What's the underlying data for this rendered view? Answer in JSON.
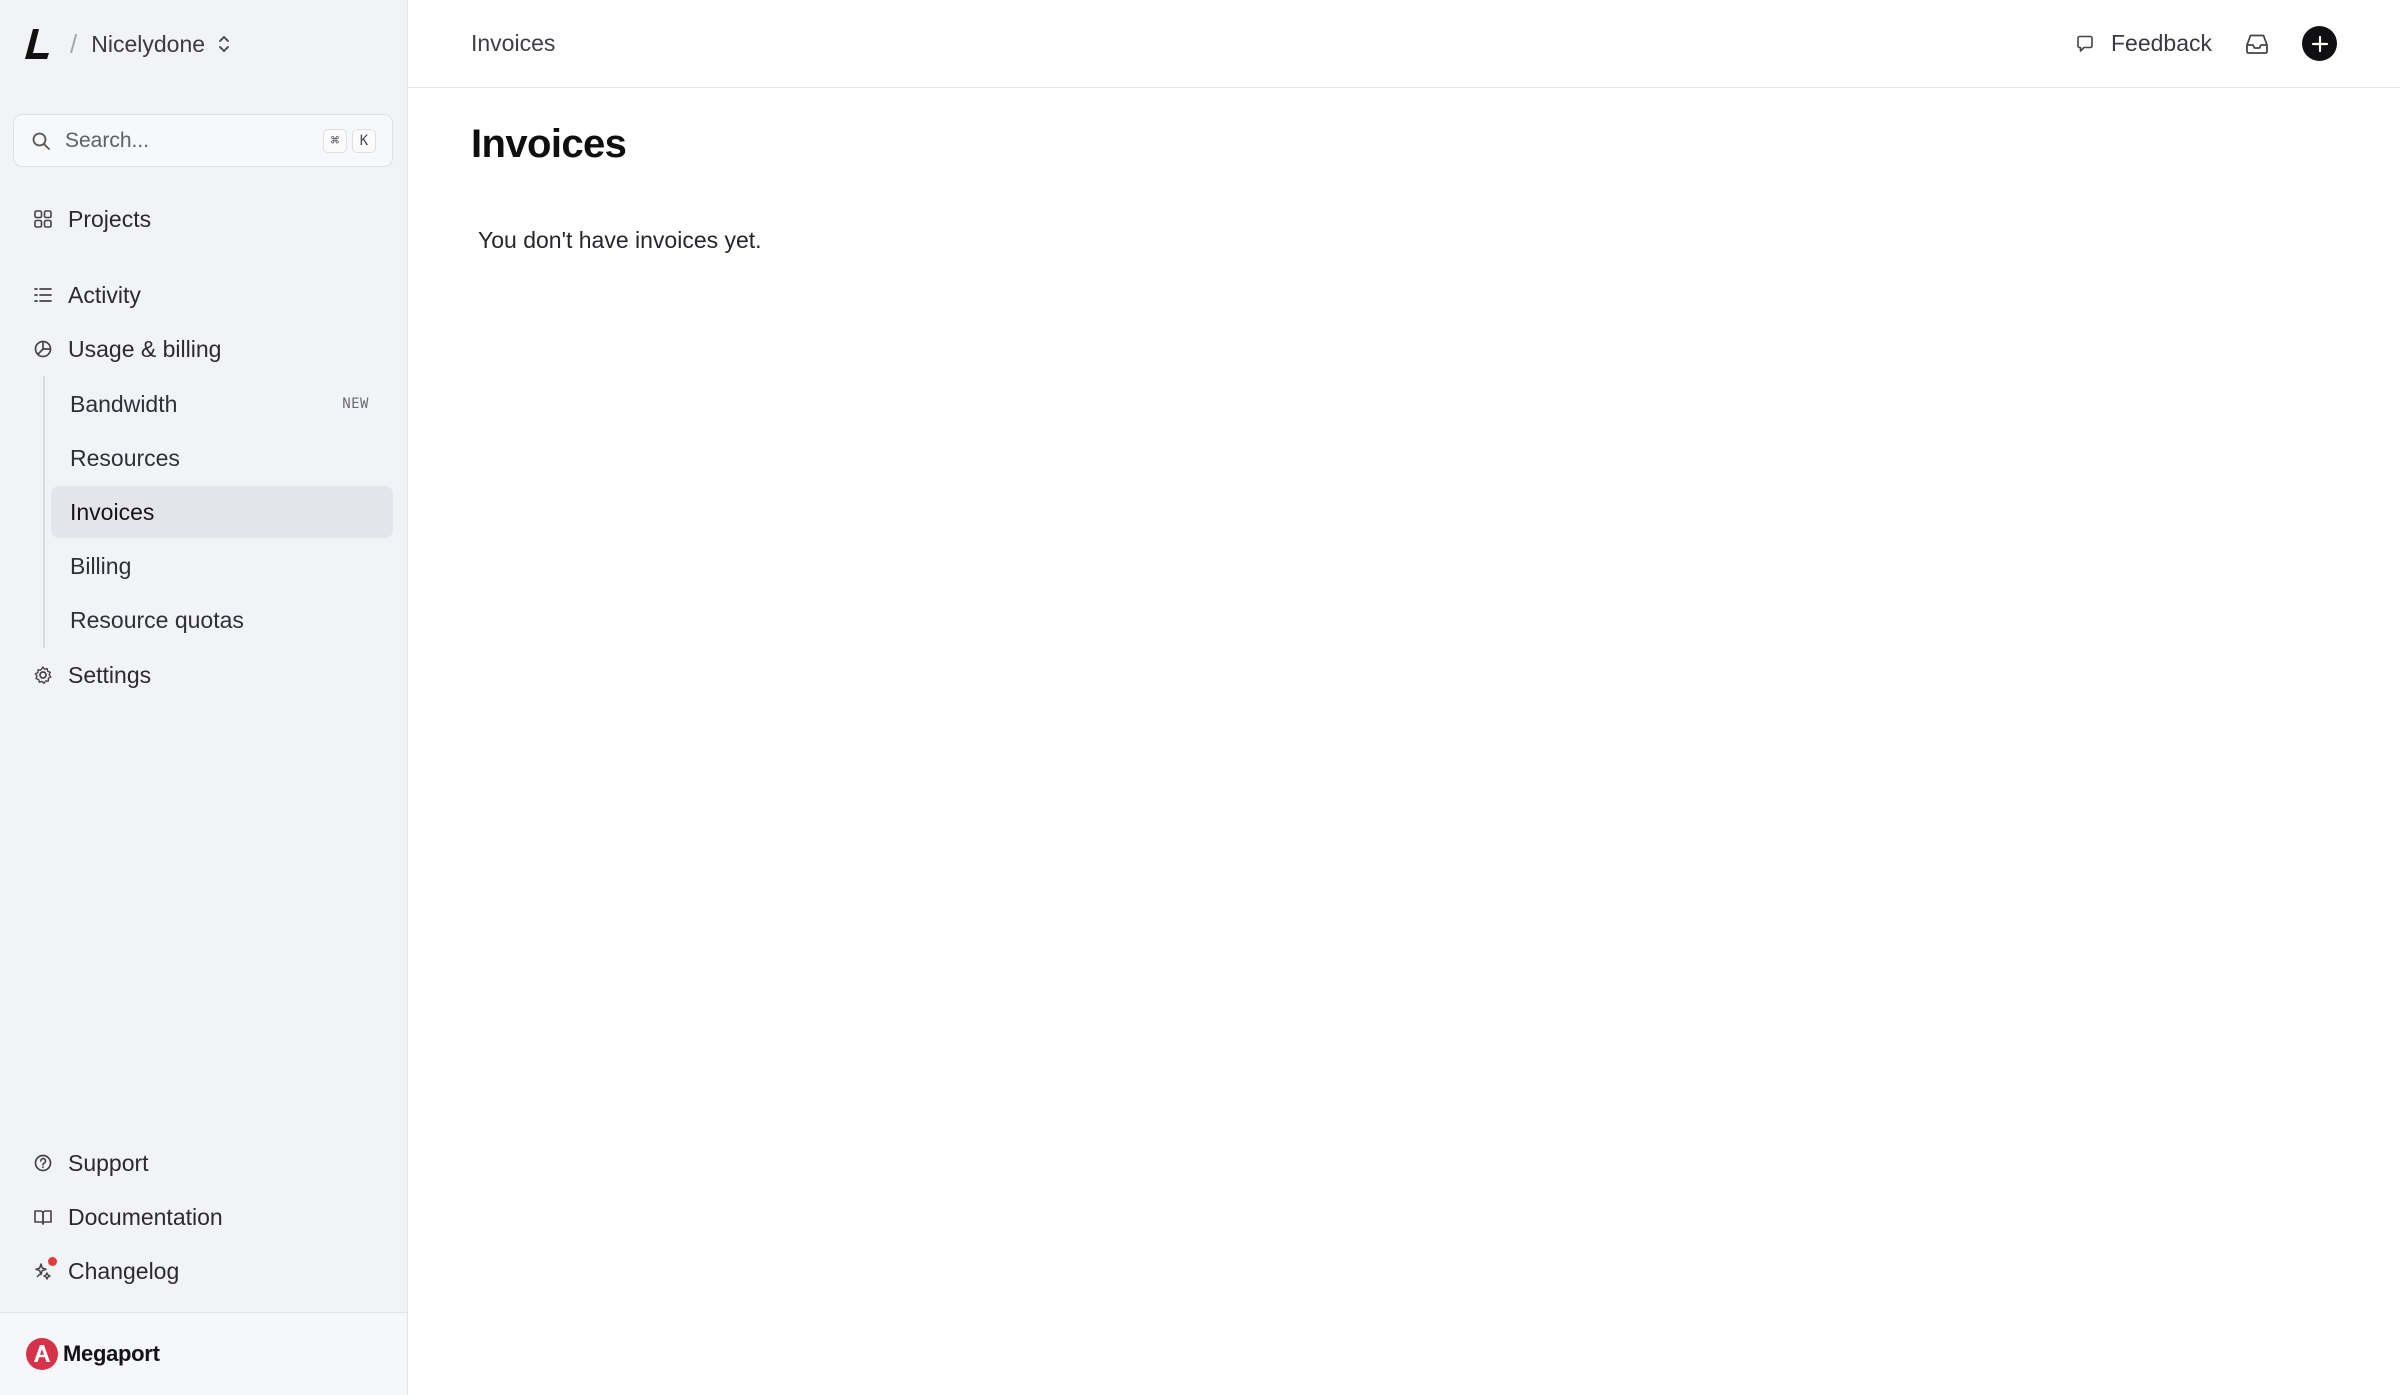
{
  "workspace": {
    "name": "Nicelydone",
    "separator": "/"
  },
  "search": {
    "placeholder": "Search...",
    "shortcut_mod": "⌘",
    "shortcut_key": "K"
  },
  "nav": {
    "projects": "Projects",
    "activity": "Activity",
    "usage_billing": "Usage & billing",
    "sub_items": [
      {
        "label": "Bandwidth",
        "badge": "NEW"
      },
      {
        "label": "Resources"
      },
      {
        "label": "Invoices",
        "active": true
      },
      {
        "label": "Billing"
      },
      {
        "label": "Resource quotas"
      }
    ],
    "settings": "Settings"
  },
  "bottom_nav": {
    "support": "Support",
    "documentation": "Documentation",
    "changelog": "Changelog"
  },
  "brand": {
    "name": "Megaport",
    "color": "#d6334b"
  },
  "topbar": {
    "breadcrumb": "Invoices",
    "feedback": "Feedback"
  },
  "main": {
    "title": "Invoices",
    "empty_message": "You don't have invoices yet."
  },
  "icons": {
    "logo": "app-logo",
    "search": "search-icon",
    "projects": "grid-icon",
    "activity": "list-icon",
    "usage": "pie-chart-icon",
    "settings": "gear-icon",
    "support": "help-circle-icon",
    "documentation": "book-icon",
    "changelog": "sparkle-icon",
    "feedback": "chat-bubble-icon",
    "inbox": "inbox-icon",
    "create": "plus-icon"
  },
  "colors": {
    "sidebar_bg": "#f2f3f7",
    "active_item_bg": "#e4e5ea",
    "notification_dot": "#e23b3b"
  }
}
